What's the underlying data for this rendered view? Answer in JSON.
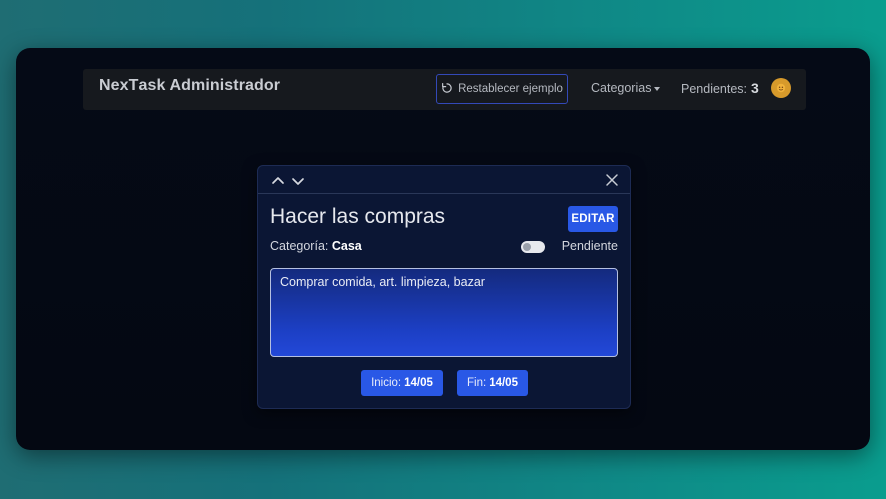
{
  "navbar": {
    "brand_part1": "Nex",
    "brand_part2": "T",
    "brand_part3": "ask Administrador",
    "reset_label": "Restablecer ejemplo",
    "categories_label": "Categorias",
    "pending_label": "Pendientes:",
    "pending_count": "3"
  },
  "modal": {
    "title": "Hacer las compras",
    "edit_label": "EDITAR",
    "category_label": "Categoría:",
    "category_value": "Casa",
    "status_label": "Pendiente",
    "description": "Comprar comida, art. limpieza, bazar",
    "start_label": "Inicio:",
    "start_value": "14/05",
    "end_label": "Fin:",
    "end_value": "14/05"
  },
  "colors": {
    "accent": "#2958e6",
    "background_gradient_start": "#1f6d73",
    "background_gradient_end": "#0a9d8e",
    "window_bg": "#050a16",
    "modal_bg": "#0b1634"
  },
  "icons": {
    "reset": "refresh-icon",
    "avatar": "sun-avatar-icon",
    "prev": "chevron-up-icon",
    "next": "chevron-down-icon",
    "close": "close-icon"
  },
  "toggle_completed": false
}
